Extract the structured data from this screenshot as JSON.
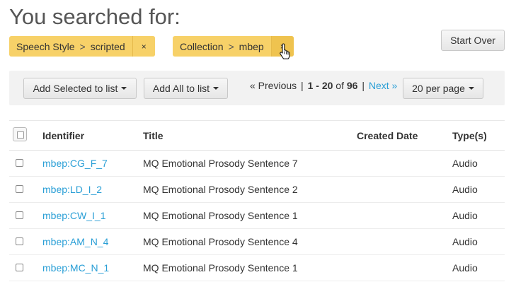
{
  "page_title": "You searched for:",
  "constraints": [
    {
      "field": "Speech Style",
      "value": "scripted",
      "remove": "×"
    },
    {
      "field": "Collection",
      "value": "mbep",
      "remove": "×"
    }
  ],
  "constraint_separator": ">",
  "start_over": "Start Over",
  "toolbar": {
    "add_selected": "Add Selected to list",
    "add_all": "Add All to list",
    "per_page": "20 per page"
  },
  "pager": {
    "previous": "« Previous",
    "range_start": "1",
    "range_sep": " - ",
    "range_end": "20",
    "of_word": " of ",
    "total": "96",
    "next": "Next »"
  },
  "table": {
    "headers": {
      "identifier": "Identifier",
      "title": "Title",
      "created": "Created Date",
      "type": "Type(s)"
    },
    "rows": [
      {
        "id": "mbep:CG_F_7",
        "title": "MQ Emotional Prosody Sentence 7",
        "created": "",
        "type": "Audio"
      },
      {
        "id": "mbep:LD_I_2",
        "title": "MQ Emotional Prosody Sentence 2",
        "created": "",
        "type": "Audio"
      },
      {
        "id": "mbep:CW_I_1",
        "title": "MQ Emotional Prosody Sentence 1",
        "created": "",
        "type": "Audio"
      },
      {
        "id": "mbep:AM_N_4",
        "title": "MQ Emotional Prosody Sentence 4",
        "created": "",
        "type": "Audio"
      },
      {
        "id": "mbep:MC_N_1",
        "title": "MQ Emotional Prosody Sentence 1",
        "created": "",
        "type": "Audio"
      }
    ]
  },
  "colors": {
    "facet_bg": "#f7d168",
    "link": "#2a9fd6",
    "toolbar_bg": "#f2f2f2"
  }
}
